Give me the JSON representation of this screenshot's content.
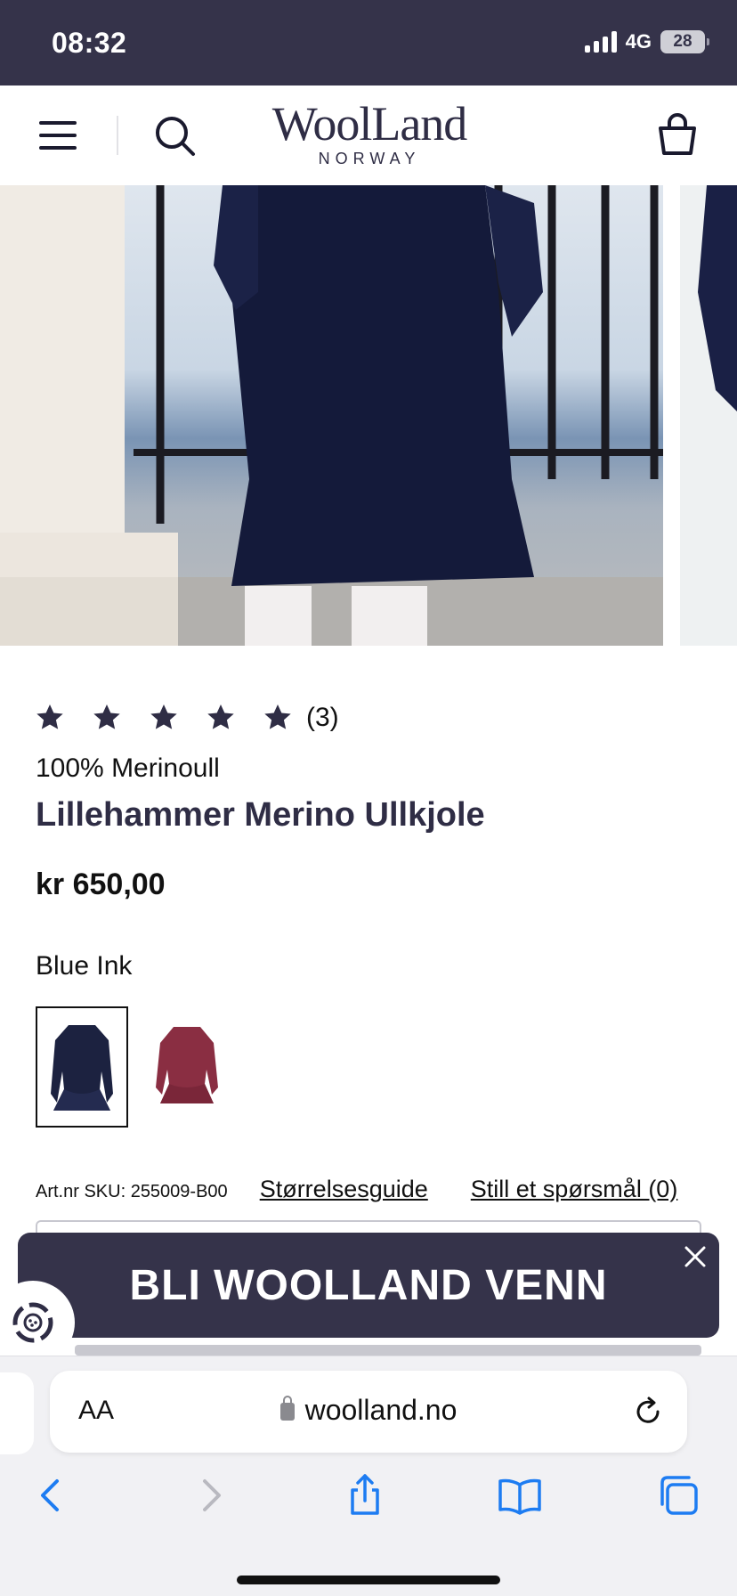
{
  "status_bar": {
    "time": "08:32",
    "network": "4G",
    "battery": "28"
  },
  "header": {
    "logo_main": "WoolLand",
    "logo_sub": "NORWAY"
  },
  "product": {
    "rating_count": "(3)",
    "stars": 5,
    "material": "100% Merinoull",
    "title": "Lillehammer Merino Ullkjole",
    "price": "kr 650,00",
    "color_name": "Blue Ink",
    "sku": "Art.nr SKU: 255009-B00",
    "size_guide_link": "Størrelsesguide",
    "question_link": "Still et spørsmål (0)"
  },
  "promo": {
    "text": "BLI WOOLLAND VENN"
  },
  "browser": {
    "aa": "AA",
    "url": "woolland.no"
  },
  "colors": {
    "brand_dark": "#35334a",
    "swatch_blue": "#1c2240",
    "swatch_red": "#8a2e42"
  }
}
